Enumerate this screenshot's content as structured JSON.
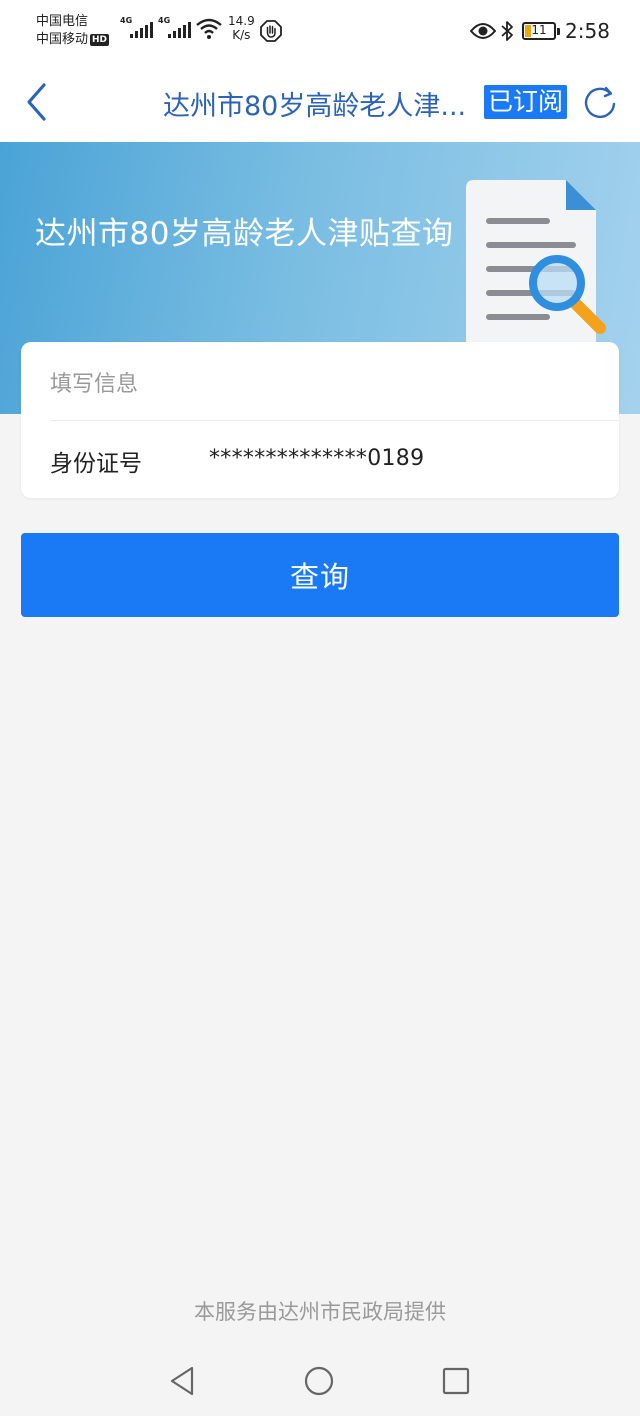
{
  "status_bar": {
    "carrier1": "中国电信",
    "carrier2": "中国移动",
    "hd": "HD",
    "signal1": "4G",
    "signal2": "4G",
    "speed_value": "14.9",
    "speed_unit": "K/s",
    "battery_level": "11",
    "time": "2:58"
  },
  "header": {
    "title": "达州市80岁高龄老人津...",
    "subscribed_label": "已订阅"
  },
  "banner": {
    "title": "达州市80岁高龄老人津贴查询"
  },
  "form": {
    "section_title": "填写信息",
    "id_label": "身份证号",
    "id_value": "**************0189"
  },
  "actions": {
    "query_label": "查询"
  },
  "footer": {
    "provider_note": "本服务由达州市民政局提供"
  },
  "colors": {
    "accent": "#1a7af5",
    "title_blue": "#2a63b8",
    "battery_orange": "#f2a413"
  }
}
